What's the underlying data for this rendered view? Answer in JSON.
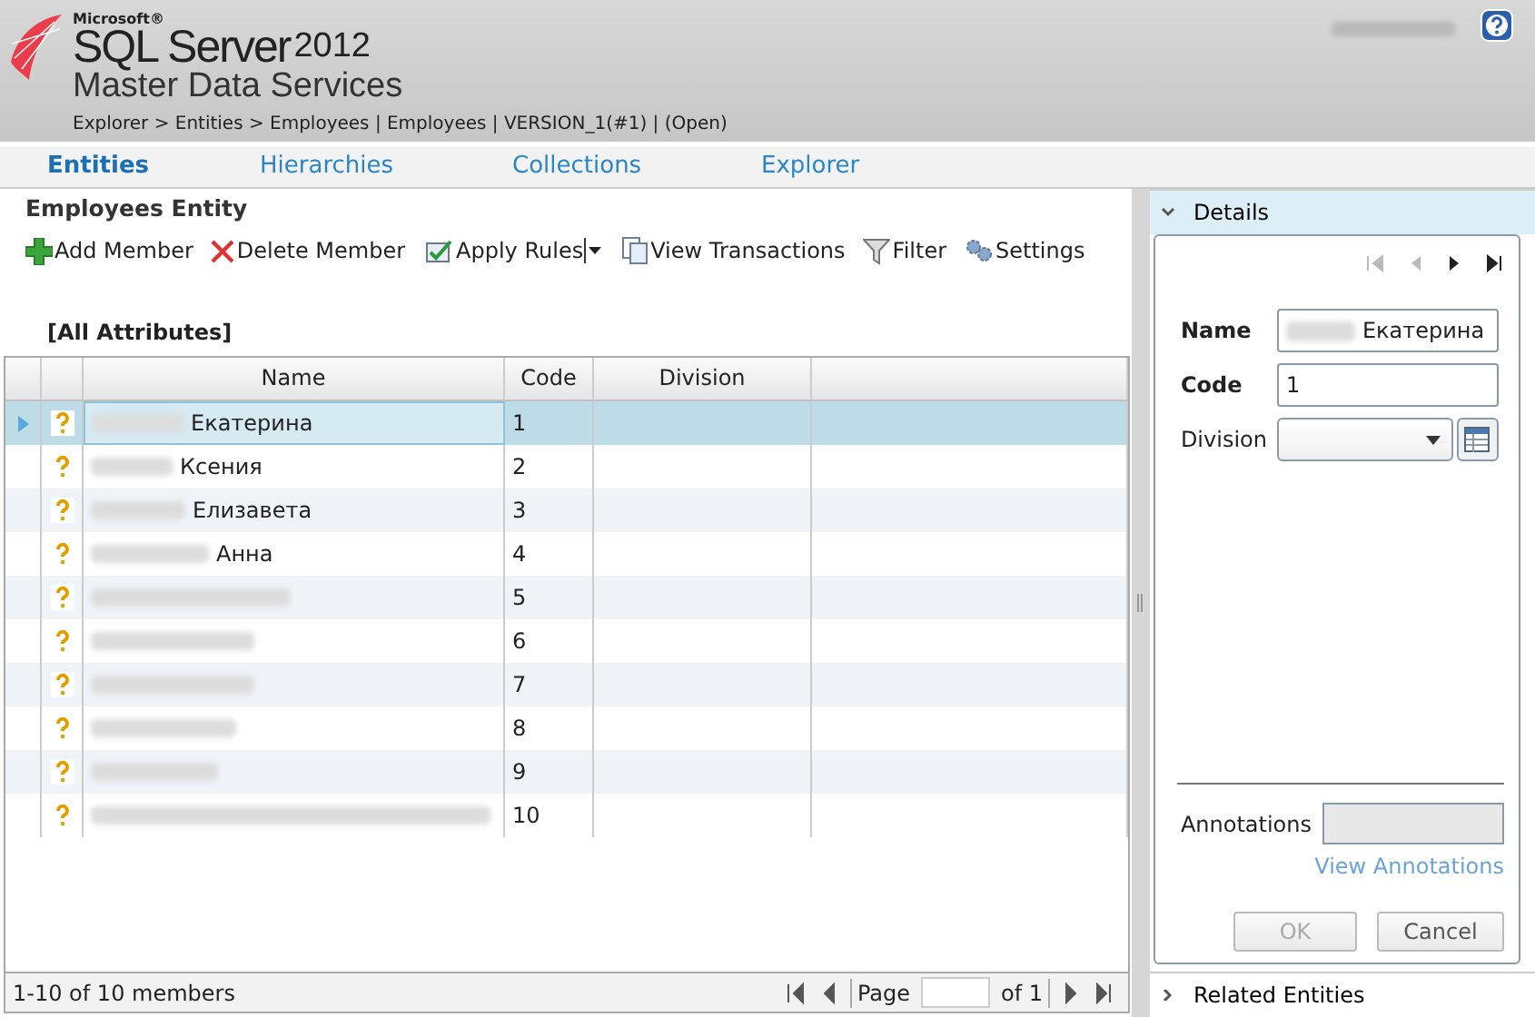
{
  "header": {
    "brand_small": "Microsoft®",
    "brand_main": "SQL Server",
    "brand_year": "2012",
    "product": "Master Data Services",
    "breadcrumb": "Explorer > Entities > Employees | Employees | VERSION_1(#1) | (Open)"
  },
  "tabs": [
    {
      "label": "Entities",
      "selected": true
    },
    {
      "label": "Hierarchies",
      "selected": false
    },
    {
      "label": "Collections",
      "selected": false
    },
    {
      "label": "Explorer",
      "selected": false
    }
  ],
  "entity_title": "Employees Entity",
  "toolbar": [
    {
      "kind": "add",
      "label": "Add Member"
    },
    {
      "kind": "delete",
      "label": "Delete Member"
    },
    {
      "kind": "rules",
      "label": "Apply Rules",
      "dropdown": true
    },
    {
      "kind": "transactions",
      "label": "View Transactions"
    },
    {
      "kind": "filter",
      "label": "Filter"
    },
    {
      "kind": "settings",
      "label": "Settings"
    }
  ],
  "attribute_set": "[All Attributes]",
  "table": {
    "columns": [
      "Name",
      "Code",
      "Division"
    ],
    "rows": [
      {
        "name": "Екатерина",
        "redacted": true,
        "code": "1",
        "selected": true
      },
      {
        "name": "Ксения",
        "redacted": true,
        "code": "2",
        "selected": false
      },
      {
        "name": "Елизавета",
        "redacted": true,
        "code": "3",
        "selected": false
      },
      {
        "name": "Анна",
        "redacted": true,
        "code": "4",
        "selected": false
      },
      {
        "redacted": true,
        "code": "5",
        "selected": false
      },
      {
        "redacted": true,
        "code": "6",
        "selected": false
      },
      {
        "redacted": true,
        "code": "7",
        "selected": false
      },
      {
        "redacted": true,
        "code": "8",
        "selected": false
      },
      {
        "redacted": true,
        "code": "9",
        "selected": false
      },
      {
        "redacted": true,
        "code": "10",
        "selected": false
      }
    ]
  },
  "status_bar": {
    "summary": "1-10 of 10 members",
    "page_label": "Page",
    "page_total": "of 1"
  },
  "details": {
    "title": "Details",
    "expanded": true,
    "nav": [
      {
        "kind": "first",
        "disabled": true
      },
      {
        "kind": "prev",
        "disabled": true
      },
      {
        "kind": "next",
        "disabled": false
      },
      {
        "kind": "last",
        "disabled": false
      }
    ],
    "fields": [
      {
        "kind": "text",
        "label": "Name",
        "required": true,
        "value": "Екатерина",
        "redacted": true
      },
      {
        "kind": "text",
        "label": "Code",
        "required": true,
        "value": "1",
        "redacted": false
      },
      {
        "kind": "select",
        "label": "Division",
        "required": false
      }
    ],
    "annotations_label": "Annotations",
    "annotations_link": "View Annotations",
    "buttons": [
      {
        "label": "OK",
        "disabled": true
      },
      {
        "label": "Cancel",
        "disabled": false
      }
    ]
  },
  "related": {
    "title": "Related Entities",
    "expanded": false
  }
}
